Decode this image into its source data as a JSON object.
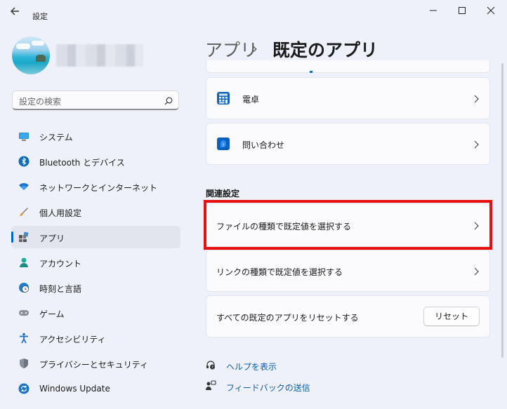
{
  "window": {
    "title": "設定"
  },
  "profile": {
    "name_obscured": true
  },
  "search": {
    "placeholder": "設定の検索"
  },
  "sidebar": {
    "items": [
      {
        "label": "システム",
        "icon": "monitor-icon"
      },
      {
        "label": "Bluetooth とデバイス",
        "icon": "bluetooth-icon"
      },
      {
        "label": "ネットワークとインターネット",
        "icon": "wifi-icon"
      },
      {
        "label": "個人用設定",
        "icon": "brush-icon"
      },
      {
        "label": "アプリ",
        "icon": "apps-icon",
        "active": true
      },
      {
        "label": "アカウント",
        "icon": "person-icon"
      },
      {
        "label": "時刻と言語",
        "icon": "clock-globe-icon"
      },
      {
        "label": "ゲーム",
        "icon": "gamepad-icon"
      },
      {
        "label": "アクセシビリティ",
        "icon": "accessibility-icon"
      },
      {
        "label": "プライバシーとセキュリティ",
        "icon": "shield-icon"
      },
      {
        "label": "Windows Update",
        "icon": "update-icon"
      }
    ]
  },
  "breadcrumb": {
    "parent": "アプリ",
    "separator": "›",
    "current": "既定のアプリ"
  },
  "apps": [
    {
      "label": "電卓",
      "icon": "calculator-icon"
    },
    {
      "label": "問い合わせ",
      "icon": "help-contact-icon"
    }
  ],
  "related": {
    "heading": "関連設定",
    "file_types": "ファイルの種類で既定値を選択する",
    "link_types": "リンクの種類で既定値を選択する",
    "reset_text": "すべての既定のアプリをリセットする",
    "reset_button": "リセット"
  },
  "footer": {
    "help": "ヘルプを表示",
    "feedback": "フィードバックの送信"
  },
  "colors": {
    "accent": "#0067c0",
    "highlight": "#e8100f",
    "link": "#0b5cad"
  }
}
